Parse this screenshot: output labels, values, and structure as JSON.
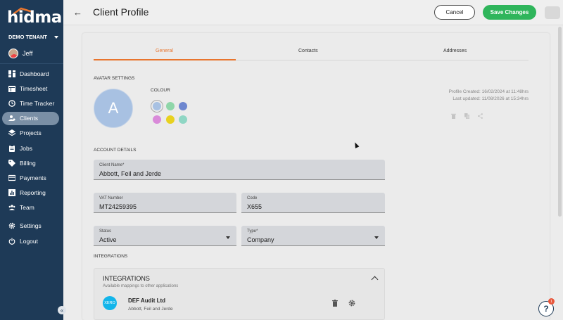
{
  "brand": {
    "logo_text": "hidma",
    "accent": "#e8752e"
  },
  "sidebar": {
    "tenant": "DEMO TENANT",
    "user": "Jeff",
    "items": [
      {
        "label": "Dashboard",
        "icon": "dashboard-icon"
      },
      {
        "label": "Timesheet",
        "icon": "timesheet-icon"
      },
      {
        "label": "Time Tracker",
        "icon": "clock-icon"
      },
      {
        "label": "Clients",
        "icon": "clients-icon",
        "active": true
      },
      {
        "label": "Projects",
        "icon": "layers-icon"
      },
      {
        "label": "Jobs",
        "icon": "clipboard-icon"
      },
      {
        "label": "Billing",
        "icon": "tag-icon"
      },
      {
        "label": "Payments",
        "icon": "card-icon"
      },
      {
        "label": "Reporting",
        "icon": "chart-icon"
      },
      {
        "label": "Team",
        "icon": "team-icon"
      },
      {
        "label": "Settings",
        "icon": "gear-icon"
      },
      {
        "label": "Logout",
        "icon": "power-icon"
      }
    ],
    "collapse_glyph": "«"
  },
  "header": {
    "title": "Client Profile",
    "cancel_label": "Cancel",
    "save_label": "Save Changes"
  },
  "tabs": [
    {
      "label": "General",
      "active": true
    },
    {
      "label": "Contacts"
    },
    {
      "label": "Addresses"
    }
  ],
  "avatar_settings": {
    "section_label": "AVATAR SETTINGS",
    "initial": "A",
    "colour_label": "COLOUR",
    "swatches": [
      "#a8c1e2",
      "#8fd6a9",
      "#6e87cf",
      "#d98ad9",
      "#e8d11f",
      "#8fd6c4"
    ],
    "selected_swatch": 0
  },
  "meta": {
    "created": "Profile Created: 16/02/2024 at 11:48hrs",
    "updated": "Last updated: 11/08/2026 at 15:34hrs"
  },
  "account": {
    "section_label": "ACCOUNT DETAILS",
    "client_name": {
      "label": "Client Name*",
      "value": "Abbott, Feil and Jerde"
    },
    "vat": {
      "label": "VAT Number",
      "value": "MT24259395"
    },
    "code": {
      "label": "Code",
      "value": "X655"
    },
    "status": {
      "label": "Status",
      "value": "Active"
    },
    "type": {
      "label": "Type*",
      "value": "Company"
    }
  },
  "integrations": {
    "section_label": "INTEGRATIONS",
    "panel_title": "INTEGRATIONS",
    "panel_subtitle": "Available mappings to other applications",
    "item": {
      "logo": "XERO",
      "name": "DEF Audit Ltd",
      "client": "Abbott, Feil and Jerde"
    }
  },
  "help": {
    "glyph": "?",
    "badge": "1"
  }
}
